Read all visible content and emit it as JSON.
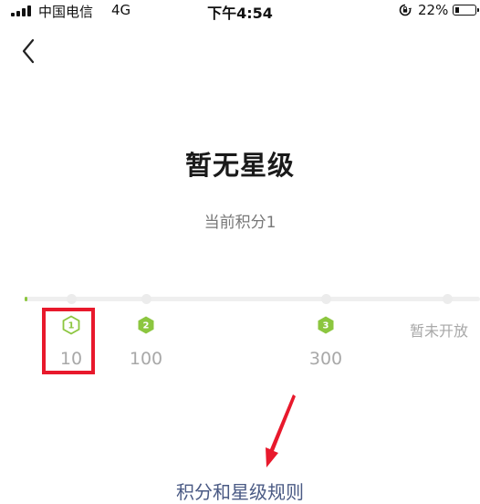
{
  "status_bar": {
    "carrier": "中国电信",
    "network": "4G",
    "time": "下午4:54",
    "battery_percent": "22%",
    "battery_level": 0.22
  },
  "header": {
    "back_icon": "chevron-left-icon"
  },
  "main": {
    "title": "暂无星级",
    "points_text": "当前积分1",
    "progress": {
      "current_points": 1,
      "levels": [
        {
          "badge": "1",
          "threshold": "10",
          "style": "outline"
        },
        {
          "badge": "2",
          "threshold": "100",
          "style": "filled"
        },
        {
          "badge": "3",
          "threshold": "300",
          "style": "filled"
        }
      ],
      "locked_label": "暂未开放"
    },
    "rules_link": "积分和星级规则"
  },
  "colors": {
    "accent_green": "#8cc63f",
    "highlight_red": "#e8192c",
    "link_blue": "#4a5a84",
    "muted_gray": "#a8a8a8"
  }
}
